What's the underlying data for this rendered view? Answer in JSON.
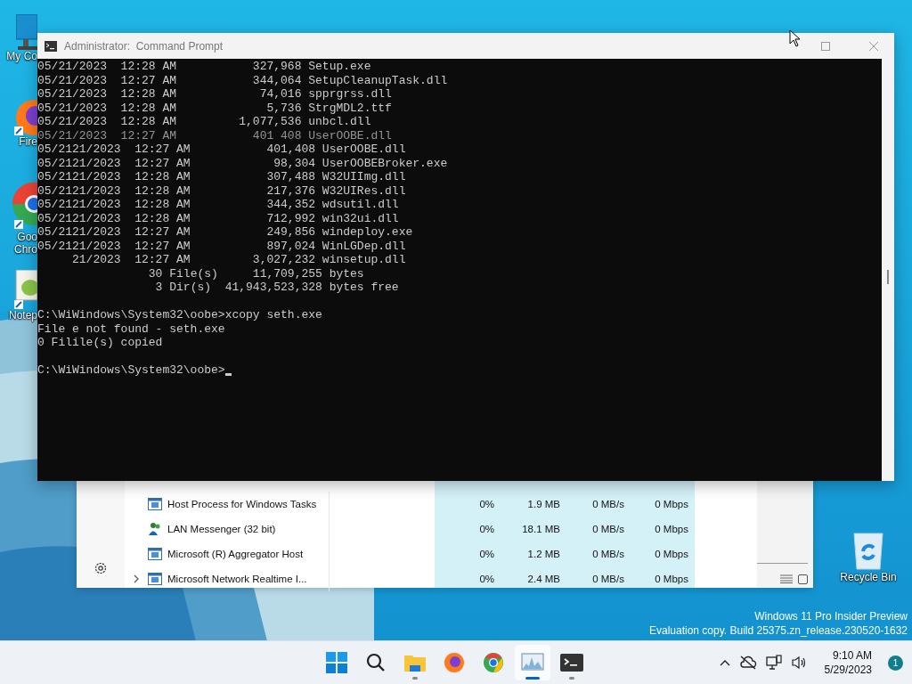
{
  "desktop_icons": [
    {
      "kind": "computer",
      "label": [
        "My Co"
      ]
    },
    {
      "kind": "firefox",
      "label": [
        "Fire"
      ]
    },
    {
      "kind": "chrome",
      "label": [
        "Goo",
        "Chro"
      ]
    },
    {
      "kind": "notepad",
      "label": [
        "Notep"
      ]
    },
    {
      "kind": "recycle",
      "label": [
        "Recycle Bin"
      ]
    }
  ],
  "console": {
    "title": "Administrator:  Command Prompt",
    "lines": [
      {
        "kind": "text",
        "text": "05/21/2023  12:28 AM           327,968 Setup.exe"
      },
      {
        "kind": "text",
        "text": "05/21/2023  12:27 AM           344,064 SetupCleanupTask.dll"
      },
      {
        "kind": "text",
        "text": "05/21/2023  12:28 AM            74,016 spprgrss.dll"
      },
      {
        "kind": "text",
        "text": "05/21/2023  12:28 AM             5,736 StrgMDL2.ttf"
      },
      {
        "kind": "text",
        "text": "05/21/2023  12:28 AM         1,077,536 unbcl.dll"
      },
      {
        "kind": "text",
        "text": "05/21/2023  12:27 AM           401 408 UserOOBE.dll",
        "cut": true
      },
      {
        "kind": "text",
        "stub": "05/21",
        "text": "21/2023  12:27 AM           401,408 UserOOBE.dll"
      },
      {
        "kind": "text",
        "stub": "05/21",
        "text": "21/2023  12:27 AM            98,304 UserOOBEBroker.exe"
      },
      {
        "kind": "text",
        "stub": "05/21",
        "text": "21/2023  12:28 AM           307,488 W32UIImg.dll"
      },
      {
        "kind": "text",
        "stub": "05/21",
        "text": "21/2023  12:28 AM           217,376 W32UIRes.dll"
      },
      {
        "kind": "text",
        "stub": "05/21",
        "text": "21/2023  12:28 AM           344,352 wdsutil.dll"
      },
      {
        "kind": "text",
        "stub": "05/21",
        "text": "21/2023  12:28 AM           712,992 win32ui.dll"
      },
      {
        "kind": "text",
        "stub": "05/21",
        "text": "21/2023  12:27 AM           249,856 windeploy.exe"
      },
      {
        "kind": "text",
        "stub": "05/21",
        "text": "21/2023  12:27 AM           897,024 WinLGDep.dll"
      },
      {
        "kind": "text",
        "text": "     21/2023  12:27 AM         3,027,232 winsetup.dll"
      },
      {
        "kind": "text",
        "text": "                30 File(s)     11,709,255 bytes"
      },
      {
        "kind": "text",
        "text": "                 3 Dir(s)  41,943,523,328 bytes free"
      },
      {
        "kind": "blank"
      },
      {
        "kind": "text",
        "stub": "C:\\Wi",
        "text": "Windows\\System32\\oobe>xcopy seth.exe"
      },
      {
        "kind": "text",
        "stub": "File",
        "text": "e not found - seth.exe"
      },
      {
        "kind": "text",
        "stub": "0 Fil",
        "text": "ile(s) copied"
      },
      {
        "kind": "blank"
      },
      {
        "kind": "text",
        "stub": "C:\\Wi",
        "text": "Windows\\System32\\oobe>",
        "cursor": true
      }
    ]
  },
  "task_manager": {
    "rows": [
      {
        "kind": "window",
        "expandable": false,
        "name": "Host Process for Windows Tasks",
        "cpu": "0%",
        "memory": "1.9 MB",
        "disk": "0 MB/s",
        "network": "0 Mbps"
      },
      {
        "kind": "people",
        "expandable": false,
        "name": "LAN Messenger (32 bit)",
        "cpu": "0%",
        "memory": "18.1 MB",
        "disk": "0 MB/s",
        "network": "0 Mbps"
      },
      {
        "kind": "window",
        "expandable": false,
        "name": "Microsoft (R) Aggregator Host",
        "cpu": "0%",
        "memory": "1.2 MB",
        "disk": "0 MB/s",
        "network": "0 Mbps"
      },
      {
        "kind": "window",
        "expandable": true,
        "name": "Microsoft Network Realtime I...",
        "cpu": "0%",
        "memory": "2.4 MB",
        "disk": "0 MB/s",
        "network": "0 Mbps"
      }
    ]
  },
  "os_notice": [
    "Windows 11 Pro Insider Preview",
    "Evaluation copy. Build 25375.zn_release.230520-1632"
  ],
  "taskbar": {
    "apps": [
      {
        "kind": "start",
        "running": false,
        "active": false
      },
      {
        "kind": "search",
        "running": false,
        "active": false
      },
      {
        "kind": "folder",
        "running": true,
        "active": false
      },
      {
        "kind": "firefox",
        "running": false,
        "active": false
      },
      {
        "kind": "chrome",
        "running": false,
        "active": false
      },
      {
        "kind": "monitor",
        "running": true,
        "active": true
      },
      {
        "kind": "terminal",
        "running": true,
        "active": false
      }
    ],
    "tray": [
      {
        "kind": "chevron"
      },
      {
        "kind": "cloud-off"
      },
      {
        "kind": "network"
      },
      {
        "kind": "volume"
      }
    ],
    "time": "9:10 AM",
    "date": "5/29/2023",
    "badge": "1"
  }
}
